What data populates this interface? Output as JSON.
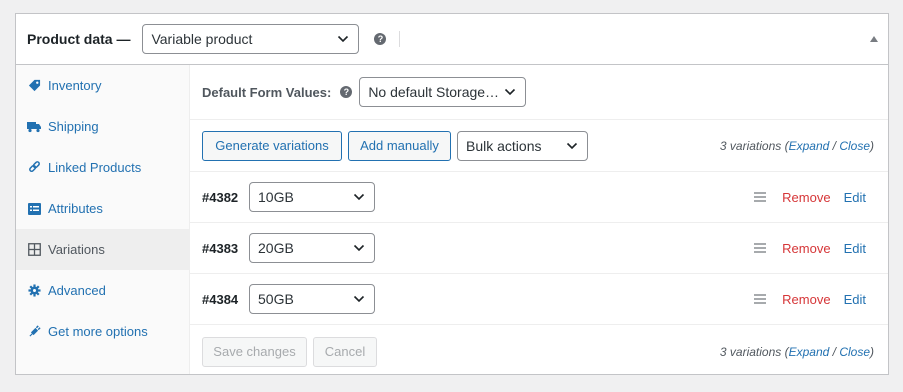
{
  "header": {
    "title": "Product data —",
    "product_type": "Variable product",
    "help_glyph": "?"
  },
  "sidebar": {
    "items": [
      {
        "label": "Inventory",
        "icon": "tag-icon",
        "active": false
      },
      {
        "label": "Shipping",
        "icon": "truck-icon",
        "active": false
      },
      {
        "label": "Linked Products",
        "icon": "link-icon",
        "active": false
      },
      {
        "label": "Attributes",
        "icon": "list-icon",
        "active": false
      },
      {
        "label": "Variations",
        "icon": "grid-icon",
        "active": true
      },
      {
        "label": "Advanced",
        "icon": "gear-icon",
        "active": false
      },
      {
        "label": "Get more options",
        "icon": "plugin-icon",
        "active": false
      }
    ]
  },
  "defaults": {
    "label": "Default Form Values:",
    "help_glyph": "?",
    "storage_value": "No default Storage…"
  },
  "toolbar": {
    "generate_label": "Generate variations",
    "add_manually_label": "Add manually",
    "bulk_actions_value": "Bulk actions",
    "count_text": "3 variations (",
    "expand_label": "Expand",
    "separator": " / ",
    "close_label": "Close",
    "close_paren": ")"
  },
  "variations": [
    {
      "id": "#4382",
      "storage": "10GB",
      "remove_label": "Remove",
      "edit_label": "Edit"
    },
    {
      "id": "#4383",
      "storage": "20GB",
      "remove_label": "Remove",
      "edit_label": "Edit"
    },
    {
      "id": "#4384",
      "storage": "50GB",
      "remove_label": "Remove",
      "edit_label": "Edit"
    }
  ],
  "footer": {
    "save_label": "Save changes",
    "cancel_label": "Cancel",
    "count_text": "3 variations (",
    "expand_label": "Expand",
    "separator": " / ",
    "close_label": "Close",
    "close_paren": ")"
  },
  "colors": {
    "link": "#2271b1",
    "remove": "#d63638",
    "active_bg": "#eeeeee",
    "border": "#c3c4c7"
  }
}
